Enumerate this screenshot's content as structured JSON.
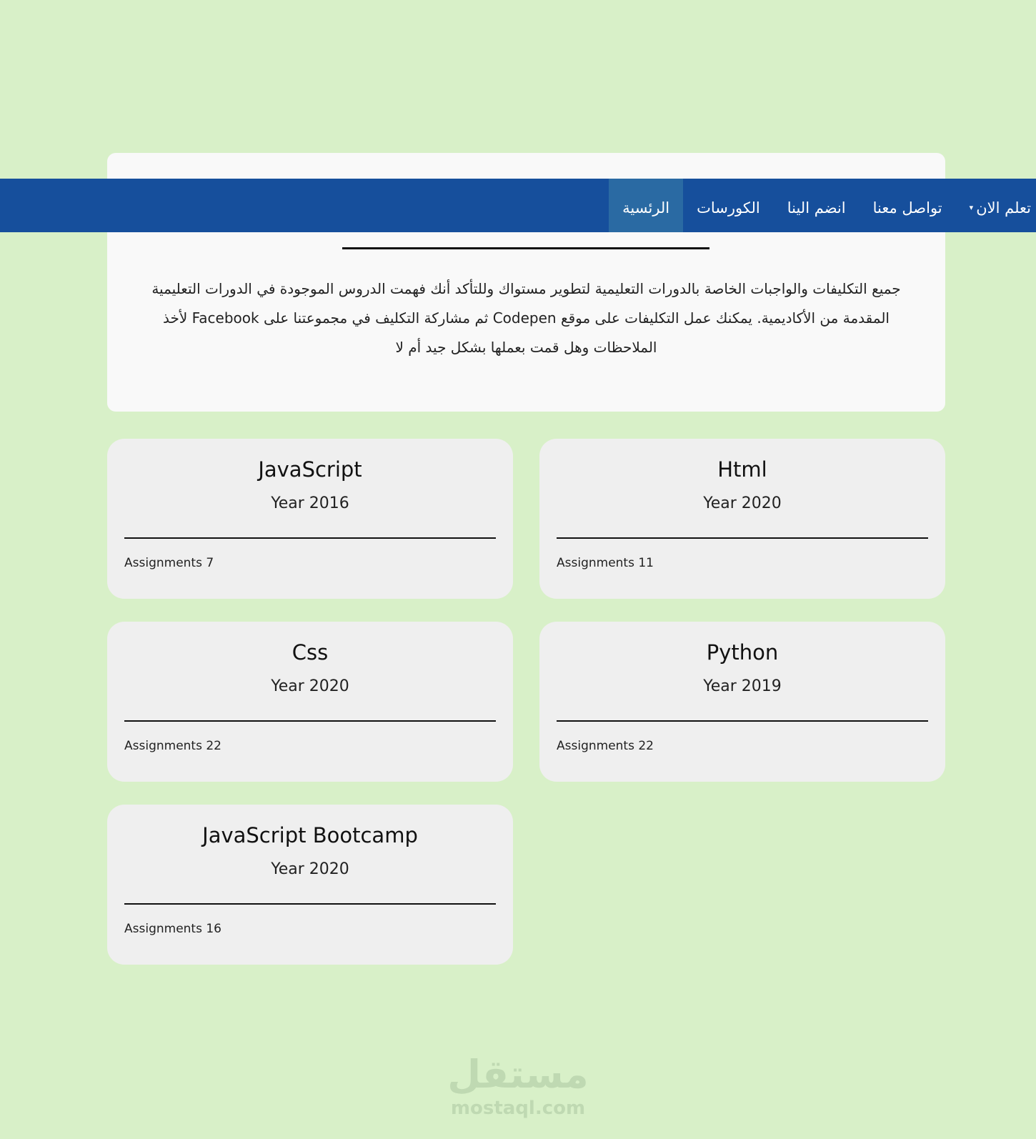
{
  "navbar": {
    "items": [
      {
        "label": "الرئسية",
        "active": true
      },
      {
        "label": "الكورسات",
        "active": false
      },
      {
        "label": "انضم الينا",
        "active": false
      },
      {
        "label": "تواصل معنا",
        "active": false
      },
      {
        "label": "تعلم الان",
        "active": false,
        "dropdown": true
      }
    ],
    "dropdown_caret": "▾"
  },
  "intro": {
    "text": "جميع التكليفات والواجبات الخاصة بالدورات التعليمية لتطوير مستواك وللتأكد أنك فهمت الدروس الموجودة في الدورات التعليمية المقدمة من الأكاديمية. يمكنك عمل التكليفات على موقع Codepen ثم مشاركة التكليف في مجموعتنا على Facebook لأخذ الملاحظات وهل قمت بعملها بشكل جيد أم لا"
  },
  "courses": [
    {
      "title": "JavaScript",
      "year": "Year 2016",
      "assignments": "Assignments 7"
    },
    {
      "title": "Html",
      "year": "Year 2020",
      "assignments": "Assignments 11"
    },
    {
      "title": "Css",
      "year": "Year 2020",
      "assignments": "Assignments 22"
    },
    {
      "title": "Python",
      "year": "Year 2019",
      "assignments": "Assignments 22"
    },
    {
      "title": "JavaScript Bootcamp",
      "year": "Year 2020",
      "assignments": "Assignments 16"
    }
  ],
  "watermark": {
    "arabic": "مستقل",
    "latin": "mostaql.com"
  },
  "colors": {
    "background": "#d8f0c8",
    "navbar": "#164f9c",
    "nav_active": "#2a6aa3",
    "card": "#efefef"
  }
}
